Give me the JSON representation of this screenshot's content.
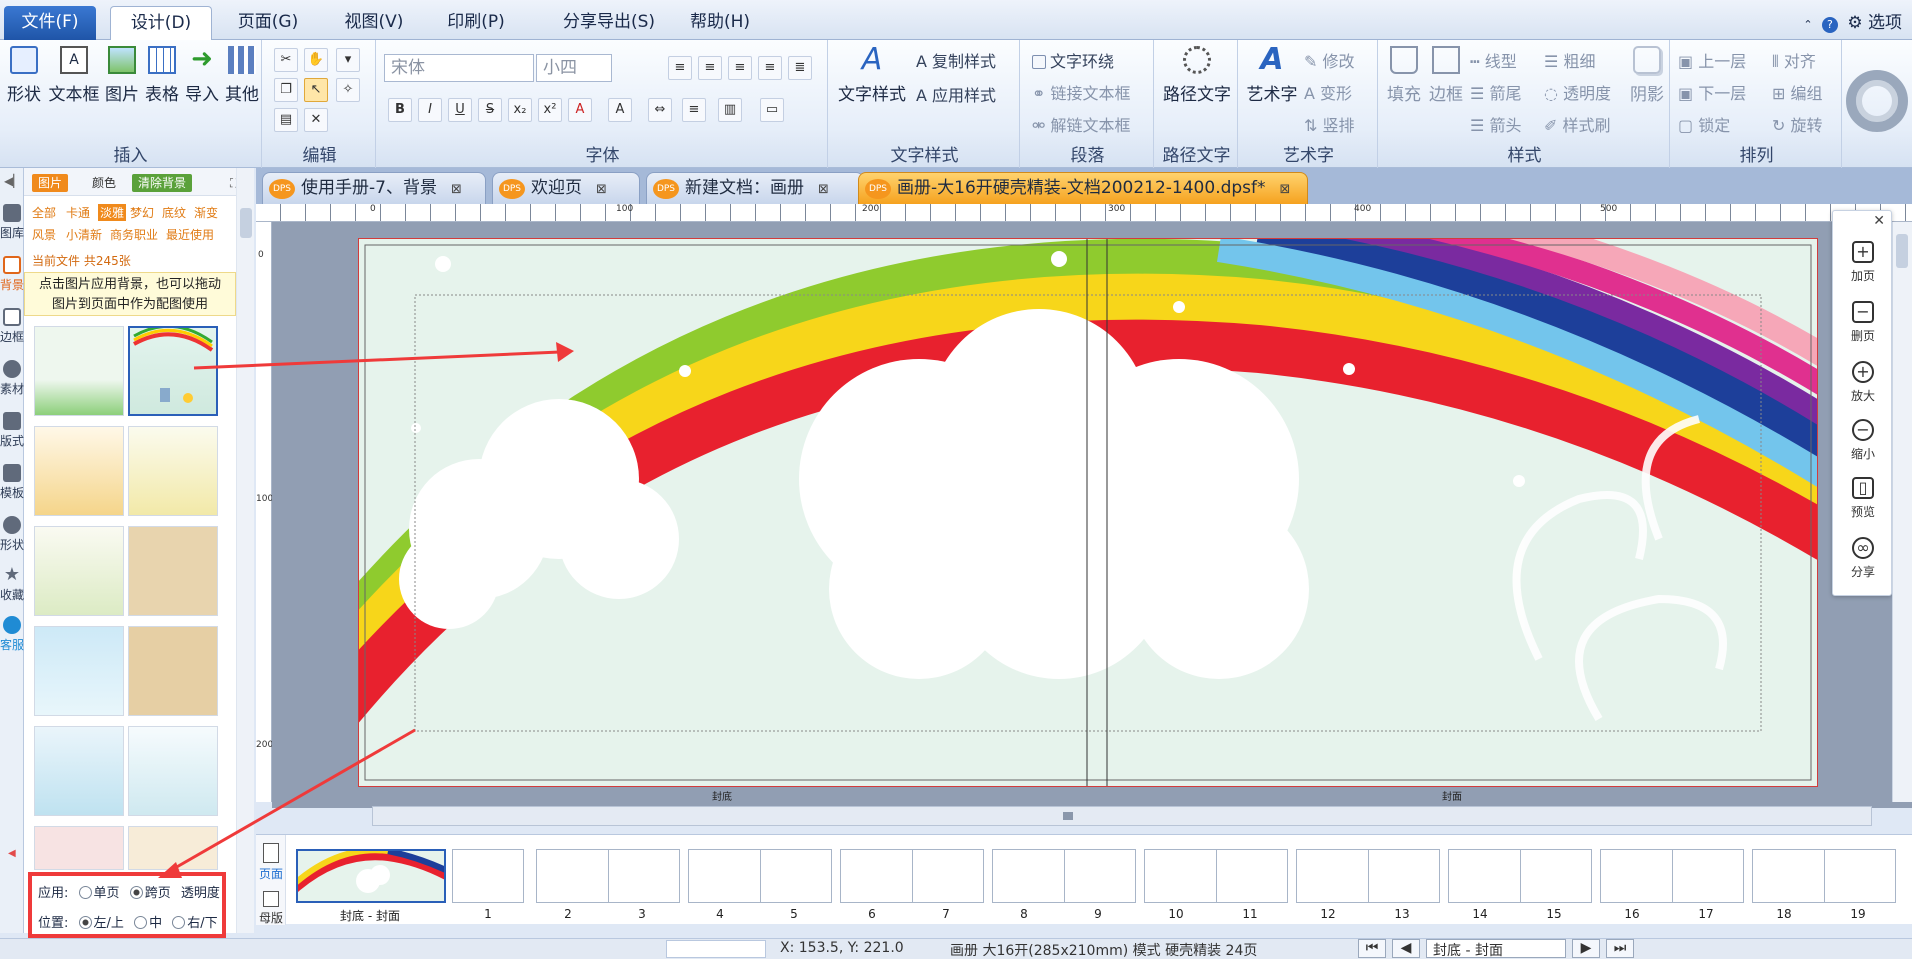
{
  "menu": {
    "file": "文件(F)",
    "design": "设计(D)",
    "page": "页面(G)",
    "view": "视图(V)",
    "print": "印刷(P)",
    "share": "分享导出(S)",
    "help": "帮助(H)",
    "options": "选项"
  },
  "ribbon": {
    "insert": {
      "group": "插入",
      "shape": "形状",
      "textbox": "文本框",
      "image": "图片",
      "table": "表格",
      "import": "导入",
      "other": "其他"
    },
    "edit": {
      "group": "编辑"
    },
    "font": {
      "group": "字体",
      "family": "宋体",
      "size": "小四"
    },
    "textstyle": {
      "group": "文字样式",
      "big": "文字样式",
      "copy": "复制样式",
      "apply": "应用样式"
    },
    "paragraph": {
      "group": "段落",
      "wrap": "文字环绕",
      "link": "链接文本框",
      "unlink": "解链文本框"
    },
    "pathtext": {
      "group": "路径文字",
      "big": "路径文字"
    },
    "arttext": {
      "group": "艺术字",
      "big": "艺术字",
      "modify": "修改",
      "transform": "变形",
      "vertical": "竖排"
    },
    "style": {
      "group": "样式",
      "fill": "填充",
      "border": "边框",
      "linetype": "线型",
      "bold": "粗细",
      "arrow_tail": "箭尾",
      "transparency": "透明度",
      "arrow_head": "箭头",
      "format_painter": "样式刷",
      "shadow": "阴影"
    },
    "arrange": {
      "group": "排列",
      "up": "上一层",
      "align": "对齐",
      "down": "下一层",
      "group_btn": "编组",
      "lock": "锁定",
      "rotate": "旋转"
    }
  },
  "sidebar": {
    "gallery": "图库",
    "background": "背景",
    "border": "边框",
    "material": "素材",
    "layout": "版式",
    "template": "模板",
    "shape": "形状",
    "favorite": "收藏",
    "service": "客服"
  },
  "panel": {
    "tabs": {
      "image": "图片",
      "color": "颜色",
      "clear": "清除背景"
    },
    "cats1": [
      "全部",
      "卡通",
      "淡雅",
      "梦幻",
      "底纹",
      "渐变"
    ],
    "cats2": [
      "风景",
      "小清新",
      "商务职业",
      "最近使用"
    ],
    "current": "当前文件 共245张",
    "hint1": "点击图片应用背景，也可以拖动",
    "hint2": "图片到页面中作为配图使用"
  },
  "options": {
    "apply_label": "应用:",
    "single": "单页",
    "spread": "跨页",
    "transparency": "透明度",
    "position_label": "位置:",
    "left_top": "左/上",
    "center": "中",
    "right_bottom": "右/下"
  },
  "doctabs": [
    "使用手册-7、背景",
    "欢迎页",
    "新建文档：画册",
    "画册-大16开硬壳精装-文档200212-1400.dpsf*"
  ],
  "ruler": {
    "h": [
      "0",
      "100",
      "200",
      "300",
      "400",
      "500"
    ],
    "v": [
      "0",
      "100",
      "200"
    ]
  },
  "rightpanel": {
    "add": "加页",
    "delete": "删页",
    "zoomin": "放大",
    "zoomout": "缩小",
    "preview": "预览",
    "share": "分享"
  },
  "canvas": {
    "left_page": "封底",
    "right_page": "封面"
  },
  "strip": {
    "page_tab": "页面",
    "master_tab": "母版",
    "cover": "封底 - 封面",
    "labels": [
      "1",
      "2",
      "3",
      "4",
      "5",
      "6",
      "7",
      "8",
      "9",
      "10",
      "11",
      "12",
      "13",
      "14",
      "15",
      "16",
      "17",
      "18",
      "19"
    ]
  },
  "status": {
    "coords": "X: 153.5, Y: 221.0",
    "spec": "画册 大16开(285x210mm) 模式 硬壳精装 24页",
    "page_select": "封底 - 封面"
  },
  "colors": {
    "accent": "#f08a1c",
    "annotation": "#ef3a3a",
    "menu_file": "#2a64c0"
  }
}
